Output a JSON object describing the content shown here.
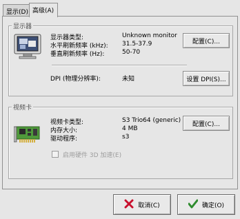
{
  "tabs": [
    {
      "label": "显示(D)"
    },
    {
      "label": "高级(A)"
    }
  ],
  "monitor_group": {
    "title": "显示器",
    "rows": [
      {
        "label": "显示器类型:",
        "value": "Unknown monitor"
      },
      {
        "label": "水平刷新频率 (kHz):",
        "value": "31.5-37.9"
      },
      {
        "label": "垂直刷新频率 (Hz):",
        "value": "50-70"
      }
    ],
    "configure_button": "配置(C)...",
    "dpi_label": "DPI (物理分辨率):",
    "dpi_value": "未知",
    "set_dpi_button": "设置 DPI(S)..."
  },
  "video_group": {
    "title": "视频卡",
    "rows": [
      {
        "label": "视频卡类型:",
        "value": "S3 Trio64 (generic)"
      },
      {
        "label": "内存大小:",
        "value": "4 MB"
      },
      {
        "label": "驱动程序:",
        "value": "s3"
      }
    ],
    "configure_button": "配置(C)...",
    "hw3d_checkbox_label": "启用硬件 3D 加速(E)",
    "hw3d_enabled": false
  },
  "dialog_buttons": {
    "cancel": "取消(C)",
    "ok": "确定(O)",
    "cancel_icon": "x-icon",
    "ok_icon": "check-icon",
    "cancel_color": "#c8102e",
    "ok_color": "#2e8b2e"
  }
}
